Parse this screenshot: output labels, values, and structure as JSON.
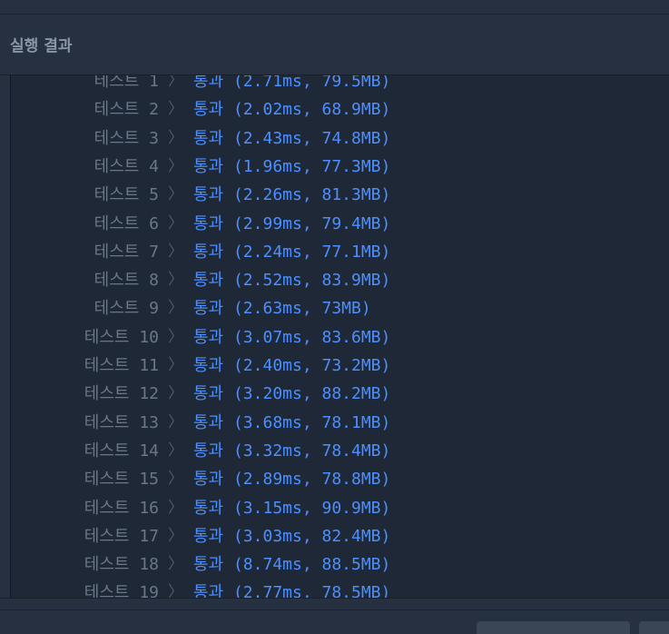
{
  "header": {
    "title": "실행 결과"
  },
  "results": [
    {
      "label": "테스트 1",
      "sep": "〉",
      "status": "통과",
      "detail": "(2.71ms, 79.5MB)"
    },
    {
      "label": "테스트 2",
      "sep": "〉",
      "status": "통과",
      "detail": "(2.02ms, 68.9MB)"
    },
    {
      "label": "테스트 3",
      "sep": "〉",
      "status": "통과",
      "detail": "(2.43ms, 74.8MB)"
    },
    {
      "label": "테스트 4",
      "sep": "〉",
      "status": "통과",
      "detail": "(1.96ms, 77.3MB)"
    },
    {
      "label": "테스트 5",
      "sep": "〉",
      "status": "통과",
      "detail": "(2.26ms, 81.3MB)"
    },
    {
      "label": "테스트 6",
      "sep": "〉",
      "status": "통과",
      "detail": "(2.99ms, 79.4MB)"
    },
    {
      "label": "테스트 7",
      "sep": "〉",
      "status": "통과",
      "detail": "(2.24ms, 77.1MB)"
    },
    {
      "label": "테스트 8",
      "sep": "〉",
      "status": "통과",
      "detail": "(2.52ms, 83.9MB)"
    },
    {
      "label": "테스트 9",
      "sep": "〉",
      "status": "통과",
      "detail": "(2.63ms, 73MB)"
    },
    {
      "label": "테스트 10",
      "sep": "〉",
      "status": "통과",
      "detail": "(3.07ms, 83.6MB)"
    },
    {
      "label": "테스트 11",
      "sep": "〉",
      "status": "통과",
      "detail": "(2.40ms, 73.2MB)"
    },
    {
      "label": "테스트 12",
      "sep": "〉",
      "status": "통과",
      "detail": "(3.20ms, 88.2MB)"
    },
    {
      "label": "테스트 13",
      "sep": "〉",
      "status": "통과",
      "detail": "(3.68ms, 78.1MB)"
    },
    {
      "label": "테스트 14",
      "sep": "〉",
      "status": "통과",
      "detail": "(3.32ms, 78.4MB)"
    },
    {
      "label": "테스트 15",
      "sep": "〉",
      "status": "통과",
      "detail": "(2.89ms, 78.8MB)"
    },
    {
      "label": "테스트 16",
      "sep": "〉",
      "status": "통과",
      "detail": "(3.15ms, 90.9MB)"
    },
    {
      "label": "테스트 17",
      "sep": "〉",
      "status": "통과",
      "detail": "(3.03ms, 82.4MB)"
    },
    {
      "label": "테스트 18",
      "sep": "〉",
      "status": "통과",
      "detail": "(8.74ms, 88.5MB)"
    },
    {
      "label": "테스트 19",
      "sep": "〉",
      "status": "통과",
      "detail": "(2.77ms, 78.5MB)"
    }
  ],
  "colors": {
    "pass": "#4d8fff",
    "label": "#6b7789",
    "panel_bg": "#1e2836",
    "chrome_bg": "#263040"
  }
}
